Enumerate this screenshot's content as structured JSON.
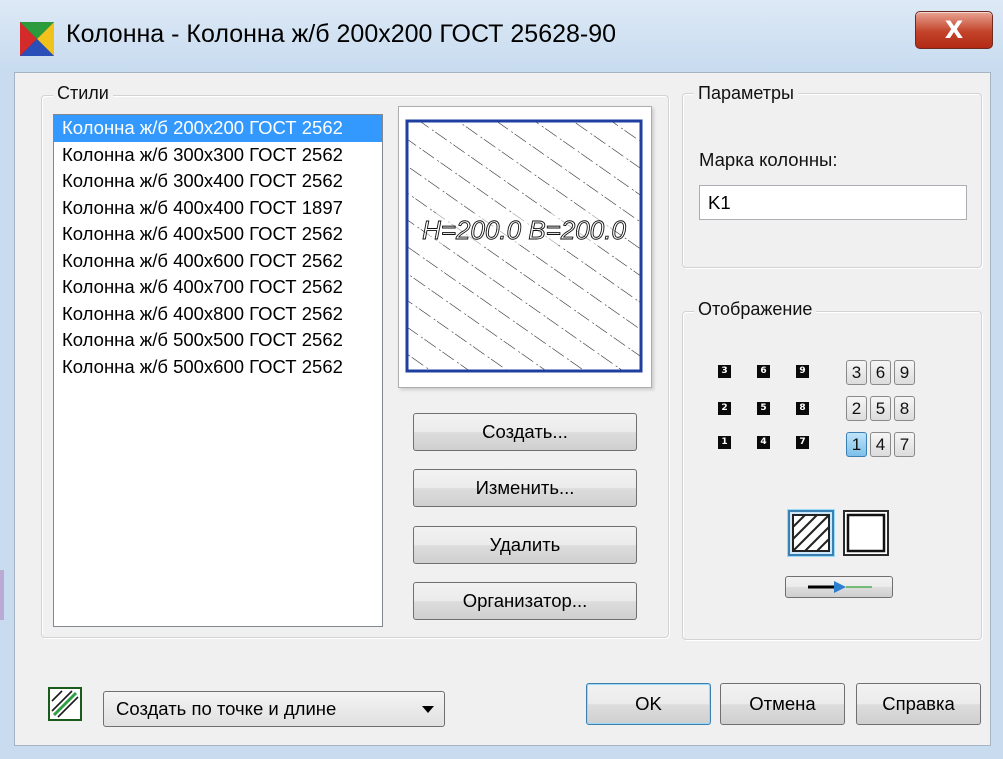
{
  "window": {
    "title": "Колонна - Колонна ж/б 200х200 ГОСТ 25628-90",
    "close_label": "X",
    "app_icon": "app-icon"
  },
  "styles": {
    "label": "Стили",
    "items": [
      "Колонна ж/б 200х200 ГОСТ 2562",
      "Колонна ж/б 300х300 ГОСТ 2562",
      "Колонна ж/б 300х400 ГОСТ 2562",
      "Колонна ж/б 400х400 ГОСТ 1897",
      "Колонна ж/б 400х500 ГОСТ 2562",
      "Колонна ж/б 400х600 ГОСТ 2562",
      "Колонна ж/б 400х700 ГОСТ 2562",
      "Колонна ж/б 400х800 ГОСТ 2562",
      "Колонна ж/б 500х500 ГОСТ 2562",
      "Колонна ж/б 500х600 ГОСТ 2562"
    ],
    "selected_index": 0
  },
  "preview": {
    "dimension_text": "H=200.0 B=200.0"
  },
  "style_buttons": {
    "create": "Создать...",
    "edit": "Изменить...",
    "delete": "Удалить",
    "organizer": "Организатор..."
  },
  "parameters": {
    "label": "Параметры",
    "mark_label": "Марка колонны:",
    "mark_value": "K1"
  },
  "display": {
    "label": "Отображение",
    "anchor_points": [
      "3",
      "6",
      "9",
      "2",
      "5",
      "8",
      "1",
      "4",
      "7"
    ],
    "anchor_buttons": [
      "3",
      "6",
      "9",
      "2",
      "5",
      "8",
      "1",
      "4",
      "7"
    ],
    "active_anchor": "1",
    "hatched_selected": true
  },
  "footer": {
    "mode_dropdown": "Создать по точке и длине",
    "ok": "OK",
    "cancel": "Отмена",
    "help": "Справка"
  },
  "colors": {
    "selection": "#3399ff",
    "frame_blue": "#1f3fa0",
    "close_red": "#c3432a"
  }
}
